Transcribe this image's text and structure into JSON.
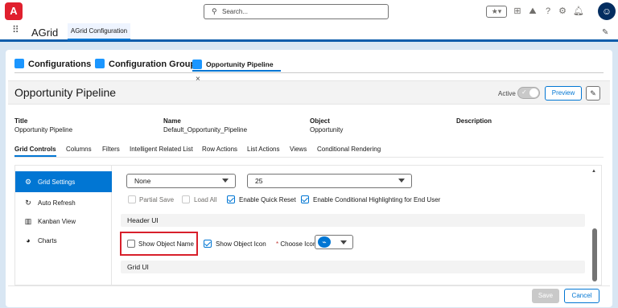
{
  "app": {
    "logo_letter": "A",
    "name": "AGrid",
    "tab_label": "AGrid Configuration"
  },
  "search": {
    "placeholder": "Search..."
  },
  "header_icons": [
    "star-icon",
    "plus-icon",
    "bell-trailhead-icon",
    "help-icon",
    "gear-icon",
    "notification-icon",
    "avatar"
  ],
  "tabs": [
    {
      "label": "Configurations",
      "active": false
    },
    {
      "label": "Configuration Groups",
      "active": false
    },
    {
      "label": "Opportunity Pipeline",
      "active": true,
      "close": "×"
    }
  ],
  "record": {
    "title": "Opportunity Pipeline",
    "active_label": "Active",
    "active_on": true,
    "preview_label": "Preview",
    "fields": [
      {
        "label": "Title",
        "value": "Opportunity Pipeline"
      },
      {
        "label": "Name",
        "value": "Default_Opportunity_Pipeline"
      },
      {
        "label": "Object",
        "value": "Opportunity"
      },
      {
        "label": "Description",
        "value": ""
      }
    ]
  },
  "subtabs": [
    "Grid Controls",
    "Columns",
    "Filters",
    "Intelligent Related List",
    "Row Actions",
    "List Actions",
    "Views",
    "Conditional Rendering"
  ],
  "sidebar": [
    {
      "label": "Grid Settings",
      "icon": "gear-icon",
      "active": true
    },
    {
      "label": "Auto Refresh",
      "icon": "refresh-icon",
      "active": false
    },
    {
      "label": "Kanban View",
      "icon": "kanban-icon",
      "active": false
    },
    {
      "label": "Charts",
      "icon": "pie-chart-icon",
      "active": false
    }
  ],
  "settings": {
    "select1_value": "None",
    "select2_value": "25",
    "checkboxes": [
      {
        "label": "Partial Save",
        "checked": false,
        "disabled": true
      },
      {
        "label": "Load All",
        "checked": false,
        "disabled": true
      },
      {
        "label": "Enable Quick Reset",
        "checked": true,
        "disabled": false
      },
      {
        "label": "Enable Conditional Highlighting for End User",
        "checked": true,
        "disabled": false
      }
    ],
    "header_ui_label": "Header UI",
    "show_object_name": {
      "label": "Show Object Name",
      "checked": false
    },
    "show_object_icon": {
      "label": "Show Object Icon",
      "checked": true
    },
    "choose_icon_label": "Choose Icon",
    "required_marker": "*",
    "grid_ui_label": "Grid UI"
  },
  "footer": {
    "save_label": "Save",
    "cancel_label": "Cancel"
  },
  "colors": {
    "brand_blue": "#0176d3",
    "highlight_red": "#d8202b",
    "logo_red": "#e0202e"
  }
}
